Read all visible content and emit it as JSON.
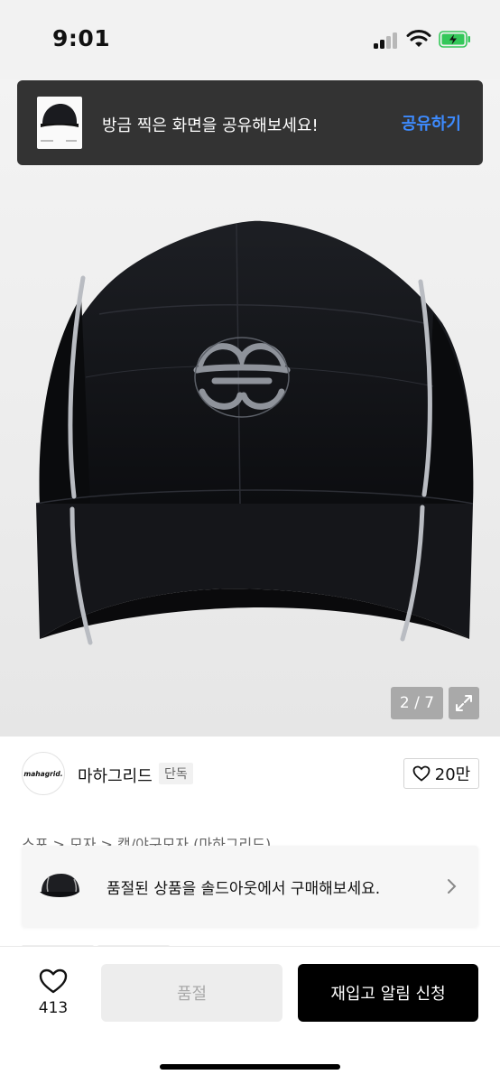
{
  "status_bar": {
    "time": "9:01"
  },
  "share_toast": {
    "message": "방금 찍은 화면을 공유해보세요!",
    "action_label": "공유하기"
  },
  "gallery": {
    "counter": "2 / 7",
    "current_index": 2,
    "total": 7
  },
  "brand": {
    "logo_text": "mahagrid.",
    "name": "마하그리드",
    "tag": "단독",
    "likes_label": "20만"
  },
  "breadcrumb": "스포 > 모자 > 캡/야구모자 (마하그리드)",
  "soldout_toast": {
    "message": "품절된 상품을 솔드아웃에서 구매해보세요."
  },
  "bottom_bar": {
    "like_count": "413",
    "soldout_label": "품절",
    "restock_label": "재입고 알림 신청"
  },
  "colors": {
    "accent": "#3d8bff",
    "toast_bg": "#333333",
    "primary_button": "#000000",
    "battery": "#34c759"
  }
}
